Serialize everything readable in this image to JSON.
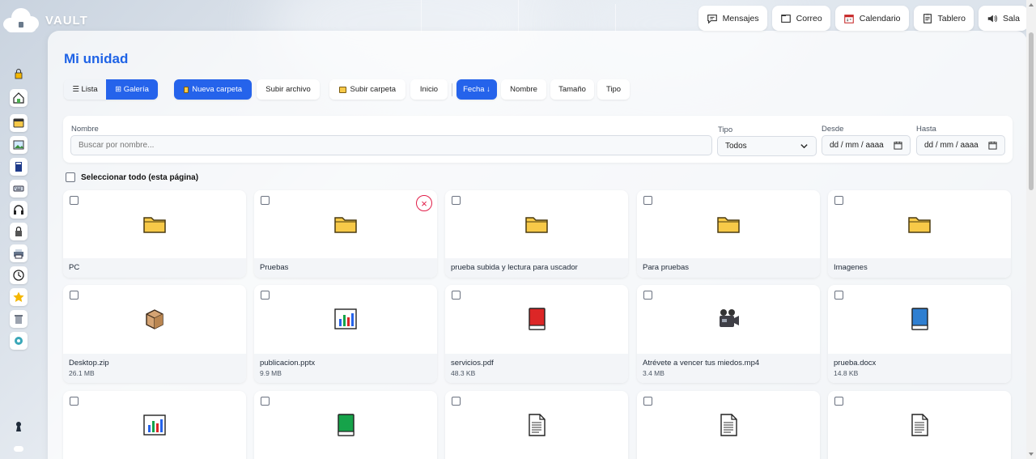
{
  "app": {
    "name": "VAULT"
  },
  "topnav": [
    {
      "label": "Mensajes",
      "icon": "chat-icon"
    },
    {
      "label": "Correo",
      "icon": "mail-icon"
    },
    {
      "label": "Calendario",
      "icon": "calendar-icon"
    },
    {
      "label": "Tablero",
      "icon": "clipboard-icon"
    },
    {
      "label": "Sala",
      "icon": "speaker-icon"
    }
  ],
  "sidebar": {
    "items": [
      {
        "icon": "lock-user-icon"
      },
      {
        "icon": "home-icon"
      },
      {
        "icon": "drive-icon"
      },
      {
        "icon": "image-icon"
      },
      {
        "icon": "book-icon"
      },
      {
        "icon": "keyboard-icon"
      },
      {
        "icon": "headphones-icon"
      },
      {
        "icon": "lock-icon"
      },
      {
        "icon": "printer-icon"
      },
      {
        "icon": "clock-icon"
      },
      {
        "icon": "star-icon"
      },
      {
        "icon": "trash-icon"
      },
      {
        "icon": "gear-icon"
      },
      {
        "icon": "vault-keyhole-icon"
      },
      {
        "icon": "toggle-icon"
      }
    ]
  },
  "main": {
    "title": "Mi unidad",
    "view": {
      "list": "☰ Lista",
      "gallery": "⊞ Galería",
      "selected": "gallery"
    },
    "actions": {
      "new_folder": "Nueva carpeta",
      "upload_file": "Subir archivo",
      "upload_folder": "Subir carpeta",
      "home": "Inicio"
    },
    "sort": {
      "date": "Fecha ↓",
      "name": "Nombre",
      "size": "Tamaño",
      "type": "Tipo",
      "active": "date"
    },
    "filter": {
      "name_label": "Nombre",
      "name_placeholder": "Buscar por nombre...",
      "type_label": "Tipo",
      "type_value": "Todos",
      "from_label": "Desde",
      "from_placeholder": "dd / mm / aaaa",
      "to_label": "Hasta",
      "to_placeholder": "dd / mm / aaaa"
    },
    "select_all": "Seleccionar todo (esta página)",
    "items": [
      {
        "name": "PC",
        "size": "",
        "icon": "folder-icon"
      },
      {
        "name": "Pruebas",
        "size": "",
        "icon": "folder-icon",
        "delete_visible": true
      },
      {
        "name": "prueba subida y lectura para uscador",
        "size": "",
        "icon": "folder-icon"
      },
      {
        "name": "Para pruebas",
        "size": "",
        "icon": "folder-icon"
      },
      {
        "name": "Imagenes",
        "size": "",
        "icon": "folder-icon"
      },
      {
        "name": "Desktop.zip",
        "size": "26.1 MB",
        "icon": "package-icon"
      },
      {
        "name": "publicacion.pptx",
        "size": "9.9 MB",
        "icon": "bar-chart-icon"
      },
      {
        "name": "servicios.pdf",
        "size": "48.3 KB",
        "icon": "red-book-icon"
      },
      {
        "name": "Atrévete a vencer tus miedos.mp4",
        "size": "3.4 MB",
        "icon": "film-camera-icon"
      },
      {
        "name": "prueba.docx",
        "size": "14.8 KB",
        "icon": "blue-book-icon"
      },
      {
        "name": "",
        "size": "",
        "icon": "bar-chart-icon"
      },
      {
        "name": "",
        "size": "",
        "icon": "green-book-icon"
      },
      {
        "name": "",
        "size": "",
        "icon": "document-icon"
      },
      {
        "name": "",
        "size": "",
        "icon": "document-icon"
      },
      {
        "name": "",
        "size": "",
        "icon": "document-icon"
      }
    ]
  },
  "colors": {
    "accent": "#2563eb",
    "title": "#1f63e6",
    "folder": "#f7c948",
    "delete": "#e11d48"
  }
}
